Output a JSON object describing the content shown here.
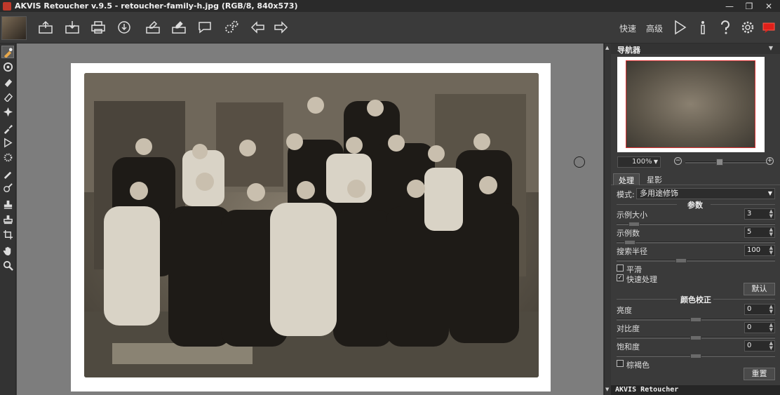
{
  "window": {
    "title": "AKVIS Retoucher v.9.5 - retoucher-family-h.jpg (RGB/8, 840x573)",
    "controls": [
      "—",
      "❐",
      "✕"
    ]
  },
  "toolbar": {
    "mode_quick": "快速",
    "mode_advanced": "高级",
    "icons": [
      "open-image-icon",
      "save-image-icon",
      "print-icon",
      "share-icon",
      "load-preset-icon",
      "save-preset-icon",
      "hint-icon",
      "settings-gears-icon",
      "undo-icon",
      "redo-icon"
    ],
    "right_icons": [
      "run-icon",
      "info-icon",
      "help-icon",
      "preferences-icon",
      "notification-icon"
    ]
  },
  "tools": [
    "retouch-brush-icon",
    "fill-tool-icon",
    "eraser-icon",
    "clone-eraser-icon",
    "spot-tool-icon",
    "restoration-brush-icon",
    "selection-arrow-icon",
    "magic-wand-icon",
    "chameleon-brush-icon",
    "healing-brush-icon",
    "stamp-icon",
    "patch-icon",
    "crop-icon",
    "hand-icon",
    "zoom-icon"
  ],
  "navigator": {
    "title": "导航器",
    "zoom": "100%",
    "zoom_minus": "−",
    "zoom_plus": "+"
  },
  "panel": {
    "tabs": [
      "处理",
      "星影"
    ],
    "mode_label": "模式:",
    "mode_value": "多用途修饰",
    "params_title": "参数",
    "params": [
      {
        "label": "示例大小",
        "value": "3",
        "level": 0.08
      },
      {
        "label": "示例数",
        "value": "5",
        "level": 0.05
      },
      {
        "label": "搜索半径",
        "value": "100",
        "level": 0.4
      }
    ],
    "smooth_label": "平滑",
    "smooth_checked": false,
    "quick_label": "快速处理",
    "quick_checked": true,
    "default_button": "默认",
    "color_title": "颜色校正",
    "color_params": [
      {
        "label": "亮度",
        "value": "0",
        "level": 0.5
      },
      {
        "label": "对比度",
        "value": "0",
        "level": 0.5
      },
      {
        "label": "饱和度",
        "value": "0",
        "level": 0.5
      }
    ],
    "sepia_label": "棕褐色",
    "sepia_checked": false,
    "reset_button": "重置",
    "footer": "AKVIS Retoucher"
  }
}
